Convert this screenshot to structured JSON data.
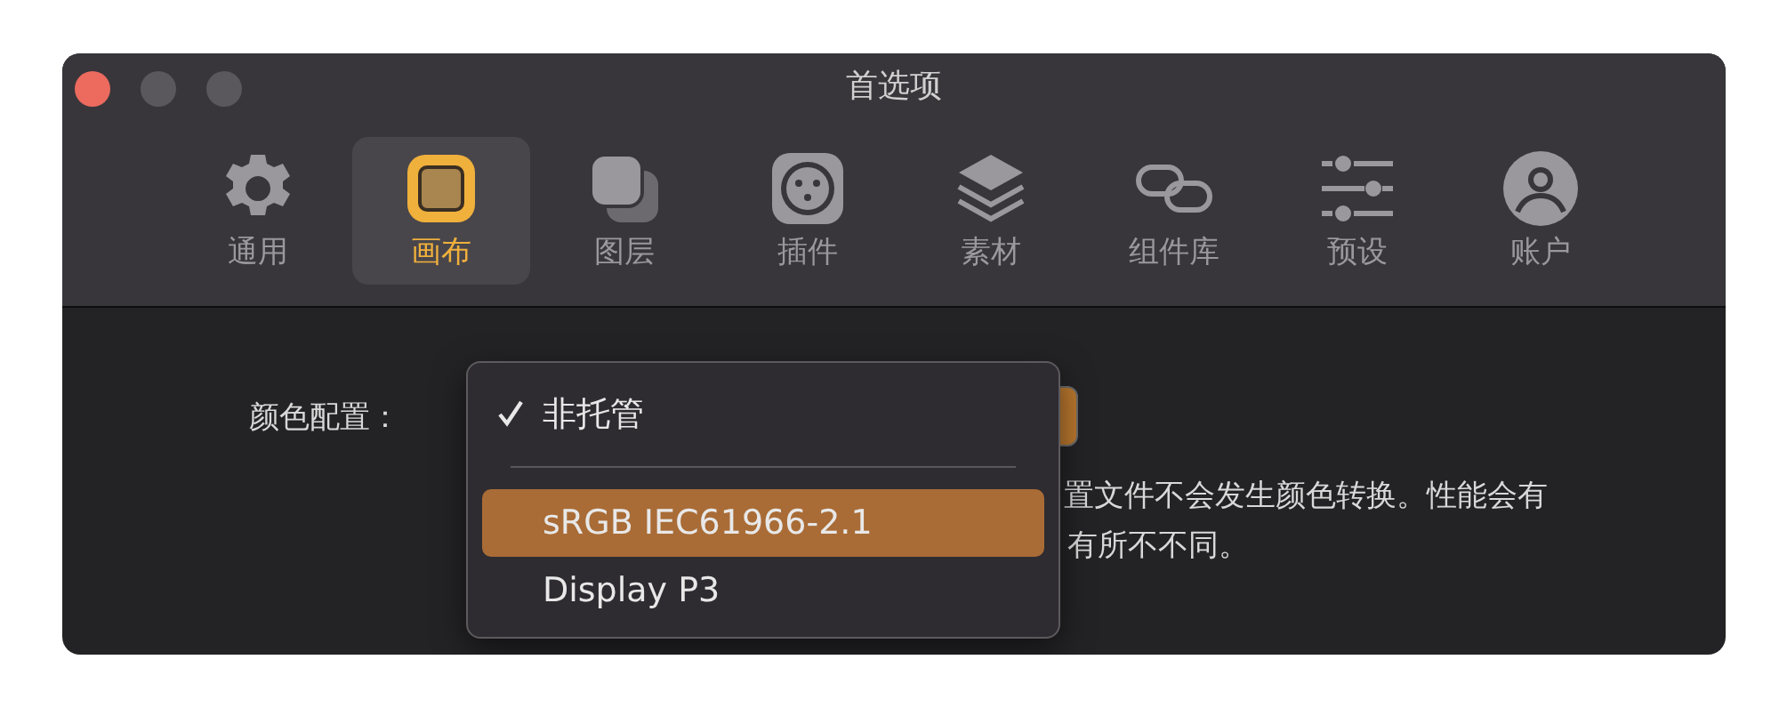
{
  "window": {
    "title": "首选项"
  },
  "toolbar": {
    "tabs": [
      {
        "label": "通用",
        "selected": false
      },
      {
        "label": "画布",
        "selected": true
      },
      {
        "label": "图层",
        "selected": false
      },
      {
        "label": "插件",
        "selected": false
      },
      {
        "label": "素材",
        "selected": false
      },
      {
        "label": "组件库",
        "selected": false
      },
      {
        "label": "预设",
        "selected": false
      },
      {
        "label": "账户",
        "selected": false
      }
    ]
  },
  "content": {
    "color_profile_label": "颜色配置：",
    "description_lines": [
      "置文件不会发生颜色转换。性能会有",
      "有所不不同。"
    ]
  },
  "menu": {
    "items": [
      {
        "kind": "item",
        "label": "非托管",
        "checked": true,
        "selected": false
      },
      {
        "kind": "separator"
      },
      {
        "kind": "item",
        "label": "sRGB IEC61966-2.1",
        "checked": false,
        "selected": true
      },
      {
        "kind": "item",
        "label": "Display P3",
        "checked": false,
        "selected": false
      }
    ]
  }
}
